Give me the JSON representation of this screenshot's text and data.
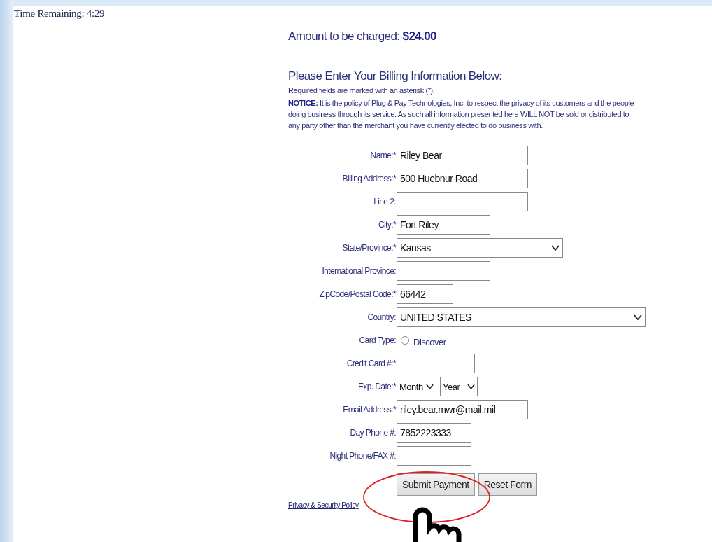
{
  "timer": {
    "label": "Time Remaining: 4:29"
  },
  "amount": {
    "label": "Amount to be charged:",
    "value": "$24.00"
  },
  "heading": "Please Enter Your Billing Information Below:",
  "required_note": "Required fields are marked with an asterisk (*).",
  "notice": "**NOTICE:** It is the policy of Plug & Pay Technologies, Inc. to respect the privacy of its customers and the people doing business through its service. As such all information presented here WILL NOT be sold or distributed to any party other than the merchant you have currently elected to do business with.",
  "fields": [
    {
      "kind": "text",
      "label": "Name:*",
      "value": "Riley Bear"
    },
    {
      "kind": "text",
      "label": "Billing Address:*",
      "value": "500 Huebnur Road"
    },
    {
      "kind": "text",
      "label": "Line 2:"
    },
    {
      "kind": "text",
      "label": "City:*",
      "value": "Fort Riley"
    },
    {
      "kind": "select",
      "label": "State/Province:*",
      "value": "Kansas"
    },
    {
      "kind": "text",
      "label": "International Province:"
    },
    {
      "kind": "text",
      "label": "ZipCode/Postal Code:*",
      "value": "66442"
    },
    {
      "kind": "select",
      "label": "Country:",
      "value": "UNITED STATES"
    },
    {
      "kind": "radio",
      "label": "Card Type:",
      "options": [
        {
          "label": "Discover",
          "selected": false
        }
      ]
    },
    {
      "kind": "text",
      "label": "Credit Card #:*"
    },
    {
      "kind": "selects",
      "label": "Exp. Date:*",
      "selects": [
        "Month",
        "Year"
      ]
    },
    {
      "kind": "text",
      "label": "Email Address:*",
      "value": "riley.bear.mwr@mail.mil"
    },
    {
      "kind": "text",
      "label": "Day Phone #:",
      "value": "7852223333"
    },
    {
      "kind": "text",
      "label": "Night Phone/FAX #:"
    }
  ],
  "buttons": [
    "Submit Payment",
    "Reset Form"
  ],
  "privacy_link": "Privacy & Security Policy"
}
